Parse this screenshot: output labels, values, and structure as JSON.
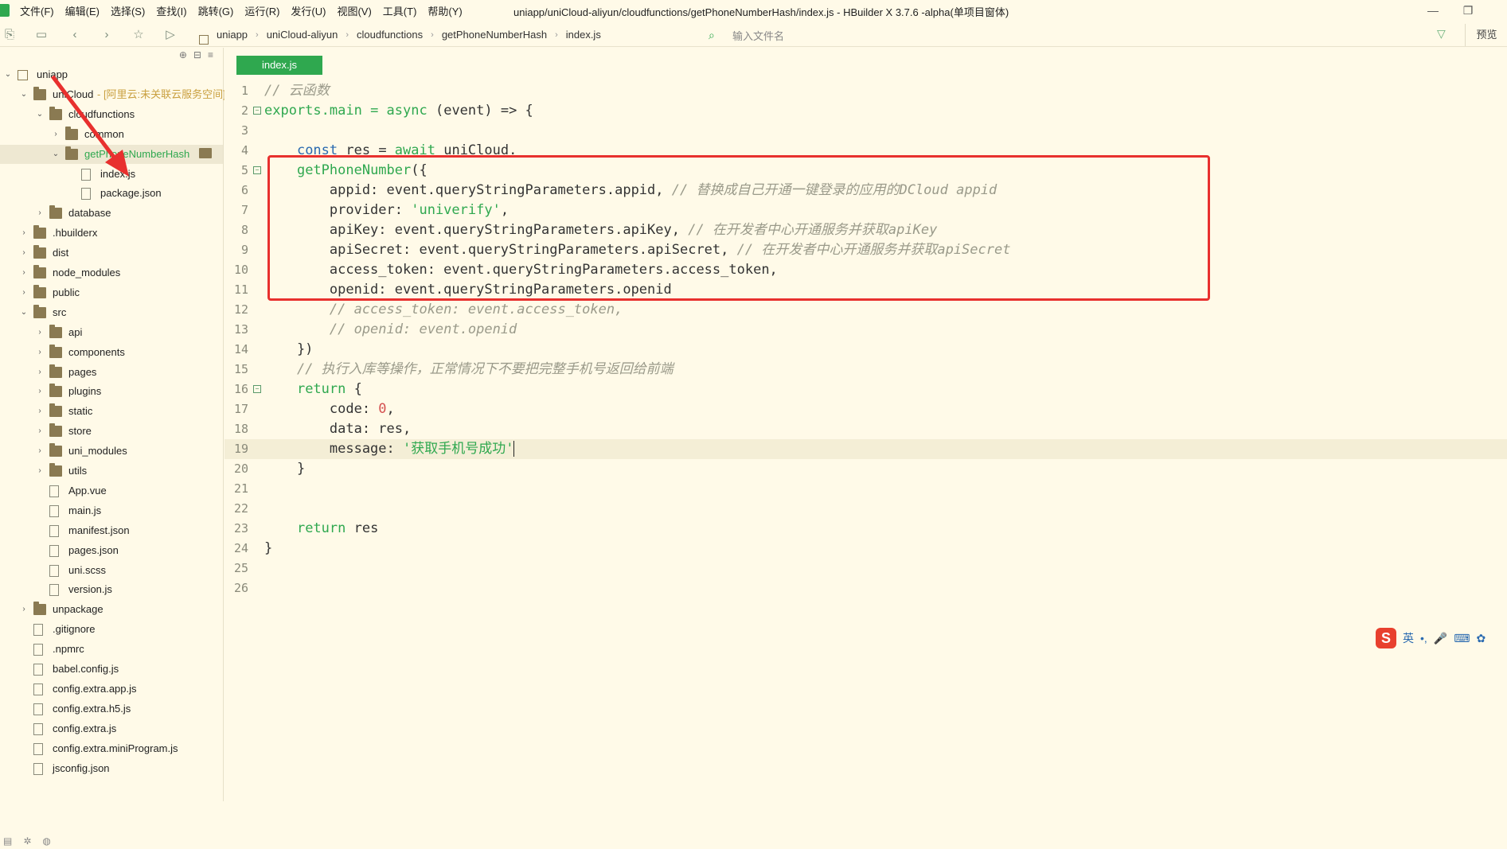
{
  "window": {
    "title": "uniapp/uniCloud-aliyun/cloudfunctions/getPhoneNumberHash/index.js - HBuilder X 3.7.6 -alpha(单项目窗体)",
    "minimize": "—",
    "restore": "❐"
  },
  "menu": [
    "文件(F)",
    "编辑(E)",
    "选择(S)",
    "查找(I)",
    "跳转(G)",
    "运行(R)",
    "发行(U)",
    "视图(V)",
    "工具(T)",
    "帮助(Y)"
  ],
  "toolbar": {
    "breadcrumbs": [
      "uniapp",
      "uniCloud-aliyun",
      "cloudfunctions",
      "getPhoneNumberHash",
      "index.js"
    ],
    "file_search_placeholder": "输入文件名",
    "preview_label": "预览"
  },
  "tree": [
    {
      "label": "uniapp",
      "depth": 0,
      "kind": "project",
      "open": true
    },
    {
      "label": "uniCloud",
      "suffix": " - [阿里云:未关联云服务空间]",
      "depth": 1,
      "kind": "folder",
      "open": true
    },
    {
      "label": "cloudfunctions",
      "depth": 2,
      "kind": "folder",
      "open": true
    },
    {
      "label": "common",
      "depth": 3,
      "kind": "folder",
      "open": false
    },
    {
      "label": "getPhoneNumberHash",
      "depth": 3,
      "kind": "folder",
      "open": true,
      "selected": true
    },
    {
      "label": "index.js",
      "depth": 4,
      "kind": "file"
    },
    {
      "label": "package.json",
      "depth": 4,
      "kind": "file"
    },
    {
      "label": "database",
      "depth": 2,
      "kind": "folder",
      "open": false
    },
    {
      "label": ".hbuilderx",
      "depth": 1,
      "kind": "folder",
      "open": false
    },
    {
      "label": "dist",
      "depth": 1,
      "kind": "folder",
      "open": false
    },
    {
      "label": "node_modules",
      "depth": 1,
      "kind": "folder",
      "open": false
    },
    {
      "label": "public",
      "depth": 1,
      "kind": "folder",
      "open": false
    },
    {
      "label": "src",
      "depth": 1,
      "kind": "folder",
      "open": true
    },
    {
      "label": "api",
      "depth": 2,
      "kind": "folder",
      "open": false
    },
    {
      "label": "components",
      "depth": 2,
      "kind": "folder",
      "open": false
    },
    {
      "label": "pages",
      "depth": 2,
      "kind": "folder",
      "open": false
    },
    {
      "label": "plugins",
      "depth": 2,
      "kind": "folder",
      "open": false
    },
    {
      "label": "static",
      "depth": 2,
      "kind": "folder",
      "open": false
    },
    {
      "label": "store",
      "depth": 2,
      "kind": "folder",
      "open": false
    },
    {
      "label": "uni_modules",
      "depth": 2,
      "kind": "folder",
      "open": false
    },
    {
      "label": "utils",
      "depth": 2,
      "kind": "folder",
      "open": false
    },
    {
      "label": "App.vue",
      "depth": 2,
      "kind": "file"
    },
    {
      "label": "main.js",
      "depth": 2,
      "kind": "file"
    },
    {
      "label": "manifest.json",
      "depth": 2,
      "kind": "file"
    },
    {
      "label": "pages.json",
      "depth": 2,
      "kind": "file"
    },
    {
      "label": "uni.scss",
      "depth": 2,
      "kind": "file"
    },
    {
      "label": "version.js",
      "depth": 2,
      "kind": "file"
    },
    {
      "label": "unpackage",
      "depth": 1,
      "kind": "folder",
      "open": false
    },
    {
      "label": ".gitignore",
      "depth": 1,
      "kind": "file"
    },
    {
      "label": ".npmrc",
      "depth": 1,
      "kind": "file"
    },
    {
      "label": "babel.config.js",
      "depth": 1,
      "kind": "file"
    },
    {
      "label": "config.extra.app.js",
      "depth": 1,
      "kind": "file"
    },
    {
      "label": "config.extra.h5.js",
      "depth": 1,
      "kind": "file"
    },
    {
      "label": "config.extra.js",
      "depth": 1,
      "kind": "file"
    },
    {
      "label": "config.extra.miniProgram.js",
      "depth": 1,
      "kind": "file"
    },
    {
      "label": "jsconfig.json",
      "depth": 1,
      "kind": "file"
    }
  ],
  "editor": {
    "tab_label": "index.js",
    "lines": [
      [
        {
          "t": "// 云函数",
          "c": "cm"
        }
      ],
      [
        {
          "t": "exports",
          "c": "kw2"
        },
        {
          "t": ".main = ",
          "c": "kw2"
        },
        {
          "t": "async",
          "c": "kw2"
        },
        {
          "t": " (event) => {",
          "c": ""
        }
      ],
      [],
      [
        {
          "t": "    ",
          "c": ""
        },
        {
          "t": "const",
          "c": "kw"
        },
        {
          "t": " res = ",
          "c": ""
        },
        {
          "t": "await",
          "c": "kw2"
        },
        {
          "t": " uniCloud.",
          "c": ""
        }
      ],
      [
        {
          "t": "    ",
          "c": ""
        },
        {
          "t": "getPhoneNumber",
          "c": "kw2"
        },
        {
          "t": "({",
          "c": ""
        }
      ],
      [
        {
          "t": "        appid: event.queryStringParameters.appid, ",
          "c": ""
        },
        {
          "t": "// 替换成自己开通一键登录的应用的DCloud appid",
          "c": "cm"
        }
      ],
      [
        {
          "t": "        provider: ",
          "c": ""
        },
        {
          "t": "'univerify'",
          "c": "str"
        },
        {
          "t": ",",
          "c": ""
        }
      ],
      [
        {
          "t": "        apiKey: event.queryStringParameters.apiKey, ",
          "c": ""
        },
        {
          "t": "// 在开发者中心开通服务并获取apiKey",
          "c": "cm"
        }
      ],
      [
        {
          "t": "        apiSecret: event.queryStringParameters.apiSecret, ",
          "c": ""
        },
        {
          "t": "// 在开发者中心开通服务并获取apiSecret",
          "c": "cm"
        }
      ],
      [
        {
          "t": "        access_token: event.queryStringParameters.access_token,",
          "c": ""
        }
      ],
      [
        {
          "t": "        openid: event.queryStringParameters.openid",
          "c": ""
        }
      ],
      [
        {
          "t": "        // access_token: event.access_token,",
          "c": "cm"
        }
      ],
      [
        {
          "t": "        // openid: event.openid",
          "c": "cm"
        }
      ],
      [
        {
          "t": "    })",
          "c": ""
        }
      ],
      [
        {
          "t": "    ",
          "c": ""
        },
        {
          "t": "// 执行入库等操作，正常情况下不要把完整手机号返回给前端",
          "c": "cm"
        }
      ],
      [
        {
          "t": "    ",
          "c": ""
        },
        {
          "t": "return",
          "c": "kw2"
        },
        {
          "t": " {",
          "c": ""
        }
      ],
      [
        {
          "t": "        code: ",
          "c": ""
        },
        {
          "t": "0",
          "c": "num"
        },
        {
          "t": ",",
          "c": ""
        }
      ],
      [
        {
          "t": "        data: res,",
          "c": ""
        }
      ],
      [
        {
          "t": "        message: ",
          "c": ""
        },
        {
          "t": "'获取手机号成功'",
          "c": "str"
        }
      ],
      [
        {
          "t": "    }",
          "c": ""
        }
      ],
      [],
      [],
      [
        {
          "t": "    ",
          "c": ""
        },
        {
          "t": "return",
          "c": "kw2"
        },
        {
          "t": " res",
          "c": ""
        }
      ],
      [
        {
          "t": "}",
          "c": ""
        }
      ],
      [],
      []
    ],
    "fold_lines": [
      2,
      5,
      16
    ],
    "current_line": 19
  },
  "ime": {
    "logo": "S",
    "lang": "英",
    "punct": "•,"
  }
}
